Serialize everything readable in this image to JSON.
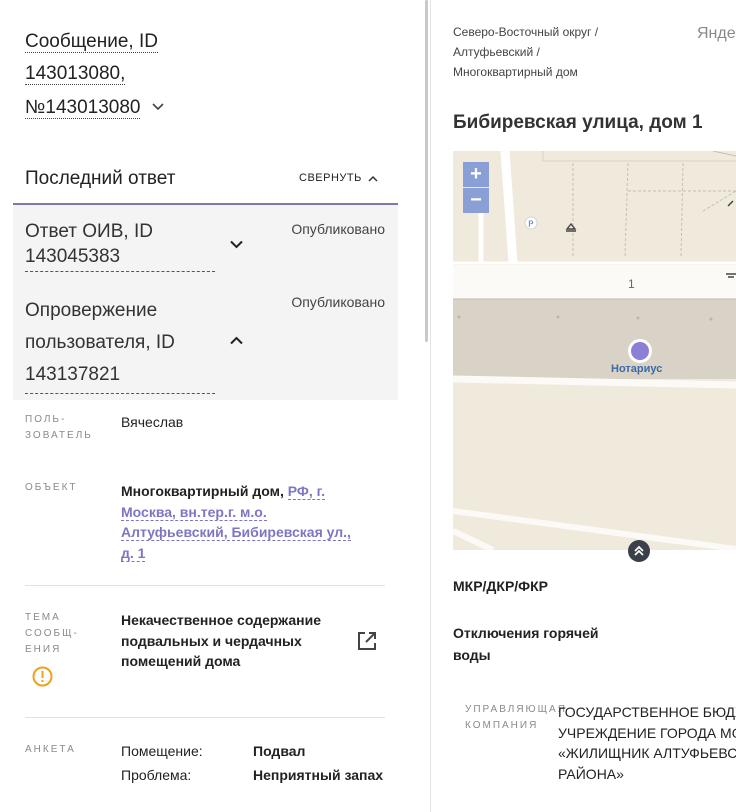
{
  "message": {
    "title_line1": "Сообщение, ID",
    "title_line2": "143013080,",
    "title_line3": "№143013080"
  },
  "last_response": {
    "header": "Последний ответ",
    "collapse_label": "СВЕРНУТЬ",
    "items": [
      {
        "label_line1": "Ответ ОИВ, ID",
        "label_line2": "143045383",
        "status": "Опубликовано"
      },
      {
        "label_line1": "Опровержение",
        "label_line2": "пользователя, ID",
        "label_line3": "143137821",
        "status": "Опубликовано"
      }
    ]
  },
  "details": {
    "user": {
      "label_line1": "ПОЛЬ-",
      "label_line2": "ЗОВАТЕЛЬ",
      "value": "Вячеслав"
    },
    "object": {
      "label": "ОБЪЕКТ",
      "type": "Многоквартирный дом,",
      "link_line1": "РФ, г.",
      "link_line2": "Москва, вн.тер.г. м.о.",
      "link_line3": "Алтуфьевский, Бибиревская ул.,",
      "link_line4": "д. 1"
    },
    "topic": {
      "label_line1": "ТЕМА",
      "label_line2": "СООБЩ-",
      "label_line3": "ЕНИЯ",
      "value_line1": "Некачественное содержание",
      "value_line2": "подвальных и чердачных",
      "value_line3": "помещений дома"
    },
    "survey": {
      "label": "АНКЕТА",
      "rows": [
        {
          "key": "Помещение:",
          "value": "Подвал"
        },
        {
          "key": "Проблема:",
          "value": "Неприятный запах"
        }
      ]
    }
  },
  "right": {
    "breadcrumb": [
      "Северо-Восточный округ /",
      "Алтуфьевский /",
      "Многоквартирный дом"
    ],
    "yandex_text": "Янде",
    "address": "Бибиревская улица, дом 1",
    "map": {
      "zoom_in": "+",
      "zoom_out": "−",
      "marker_label": "Нотариус",
      "building_number": "1"
    },
    "program": "МКР/ДКР/ФКР",
    "hot_water_line1": "Отключения горячей",
    "hot_water_line2": "воды",
    "management": {
      "label_line1": "УПРАВЛЯЮЩАЯ",
      "label_line2": "КОМПАНИЯ",
      "value_line1": "ГОСУДАРСТВЕННОЕ БЮДЖ",
      "value_line2": "УЧРЕЖДЕНИЕ ГОРОДА МОС",
      "value_line3": "«ЖИЛИЩНИК АЛТУФЬЕВСК",
      "value_line4": "РАЙОНА»"
    }
  },
  "colors": {
    "accent": "#7d76c4",
    "warning": "#f0a020",
    "map_bg": "#efeadb",
    "zoom": "#8a9fd6"
  }
}
